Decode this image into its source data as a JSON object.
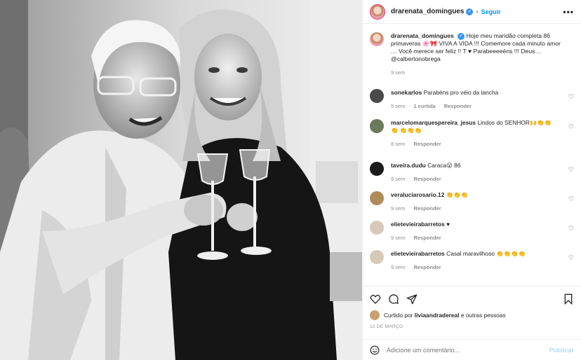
{
  "header": {
    "username": "drarenata_domingues",
    "dot": "•",
    "follow_label": "Seguir",
    "more_label": "•••"
  },
  "caption": {
    "username": "drarenata_domingues",
    "text": "Hoje meu maridão completa 86 primaveras 🌸🎀 VIVA A VIDA !!! Comemore cada minuto amor … Você merece ser feliz !! T ♥ Parabeeeeéns !!! Deus… @calbertonobrega",
    "time": "9 sem"
  },
  "comments": [
    {
      "username": "sonekarlos",
      "text": "Parabéns pro véio da lancha",
      "time": "5 sem",
      "likes": "1 curtida",
      "reply": "Responder",
      "avatar_color": "#4a4a4a"
    },
    {
      "username": "marcelomarquespereira_jesus",
      "text": "Lindos do SENHOR🙌👏👏👏 👏👏👏",
      "time": "8 sem",
      "likes": "",
      "reply": "Responder",
      "avatar_color": "#6a7a5a"
    },
    {
      "username": "taveira.dudu",
      "text": "Caraca😮 86",
      "time": "9 sem",
      "likes": "",
      "reply": "Responder",
      "avatar_color": "#1a1a1a"
    },
    {
      "username": "veraluciarosario.12",
      "text": "👏👏👏",
      "time": "9 sem",
      "likes": "",
      "reply": "Responder",
      "avatar_color": "#b08a5a"
    },
    {
      "username": "elietevieirabarretos",
      "text": "♥",
      "time": "9 sem",
      "likes": "",
      "reply": "Responder",
      "avatar_color": "#d8c8b8"
    },
    {
      "username": "elietevieirabarretos",
      "text": "Casal maravilhoso 👏👏👏👏",
      "time": "9 sem",
      "likes": "",
      "reply": "Responder",
      "avatar_color": "#d8c8b8"
    }
  ],
  "actions": {
    "liked_by_prefix": "Curtido por",
    "liked_by_user": "liviaandradereal",
    "liked_by_suffix": "e outras pessoas",
    "date": "12 DE MARÇO"
  },
  "add_comment": {
    "placeholder": "Adicione um comentário...",
    "post_label": "Publicar"
  },
  "colors": {
    "accent": "#0095f6",
    "verified": "#3897f0",
    "muted": "#8e8e8e"
  }
}
